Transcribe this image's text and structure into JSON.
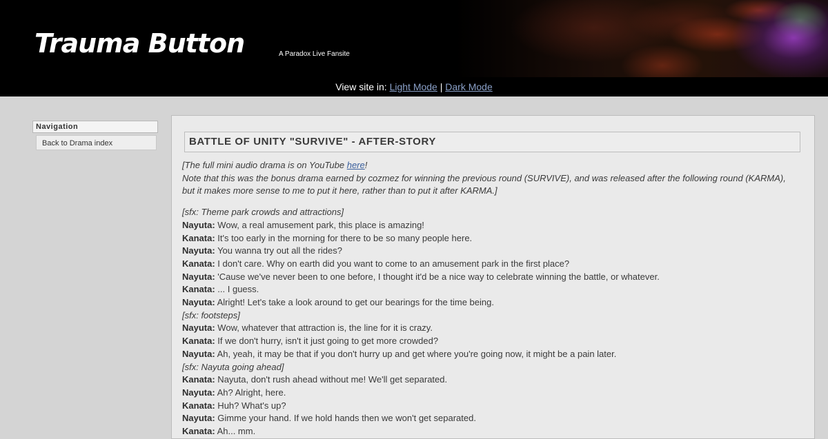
{
  "header": {
    "site_title": "Trauma Button",
    "tagline": "A Paradox Live Fansite",
    "view_label": "View site in:",
    "light_mode": "Light Mode",
    "separator": "|",
    "dark_mode": "Dark Mode"
  },
  "sidebar": {
    "title": "Navigation",
    "items": [
      {
        "label": "Back to Drama index"
      }
    ]
  },
  "main": {
    "title": "BATTLE OF UNITY \"SURVIVE\" - AFTER-STORY",
    "notes": {
      "line1_pre": "[The full mini audio drama is on YouTube ",
      "line1_link": "here",
      "line1_post": "!",
      "line2": "Note that this was the bonus drama earned by cozmez for winning the previous round (SURVIVE), and was released after the following round (KARMA),",
      "line3": "but it makes more sense to me to put it here, rather than to put it after KARMA.]"
    },
    "script": [
      {
        "sfx": "[sfx: Theme park crowds and attractions]"
      },
      {
        "speaker": "Nayuta:",
        "text": " Wow, a real amusement park, this place is amazing!"
      },
      {
        "speaker": "Kanata:",
        "text": " It's too early in the morning for there to be so many people here."
      },
      {
        "speaker": "Nayuta:",
        "text": " You wanna try out all the rides?"
      },
      {
        "speaker": "Kanata:",
        "text": " I don't care. Why on earth did you want to come to an amusement park in the first place?"
      },
      {
        "speaker": "Nayuta:",
        "text": " 'Cause we've never been to one before, I thought it'd be a nice way to celebrate winning the battle, or whatever."
      },
      {
        "speaker": "Kanata:",
        "text": " ... I guess."
      },
      {
        "speaker": "Nayuta:",
        "text": " Alright! Let's take a look around to get our bearings for the time being."
      },
      {
        "sfx": "[sfx: footsteps]"
      },
      {
        "speaker": "Nayuta:",
        "text": " Wow, whatever that attraction is, the line for it is crazy."
      },
      {
        "speaker": "Kanata:",
        "text": " If we don't hurry, isn't it just going to get more crowded?"
      },
      {
        "speaker": "Nayuta:",
        "text": " Ah, yeah, it may be that if you don't hurry up and get where you're going now, it might be a pain later."
      },
      {
        "sfx": "[sfx: Nayuta going ahead]"
      },
      {
        "speaker": "Kanata:",
        "text": " Nayuta, don't rush ahead without me! We'll get separated."
      },
      {
        "speaker": "Nayuta:",
        "text": " Ah? Alright, here."
      },
      {
        "speaker": "Kanata:",
        "text": " Huh? What's up?"
      },
      {
        "speaker": "Nayuta:",
        "text": " Gimme your hand. If we hold hands then we won't get separated."
      },
      {
        "speaker": "Kanata:",
        "text": " Ah... mm."
      }
    ]
  }
}
